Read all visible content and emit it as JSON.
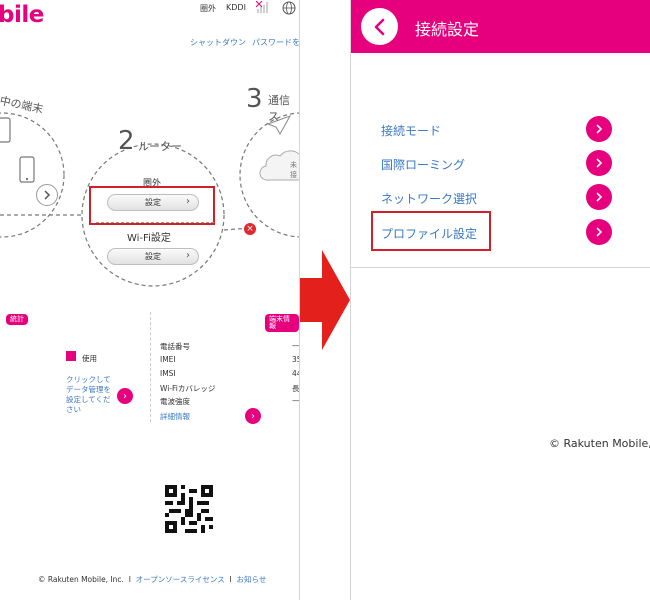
{
  "left": {
    "logo": "bile",
    "top": {
      "status": "圏外",
      "carrier": "KDDI"
    },
    "links": {
      "shutdown": "シャットダウン",
      "password": "パスワードを"
    },
    "devices_label": "中の端末",
    "router_num": "2",
    "router_label": "ルーター",
    "comm_num": "3",
    "comm_label": "通信ス",
    "cloud_text": "未接",
    "router_status": "圏外",
    "settings_btn": "設定",
    "wifi_label": "Wi-Fi設定",
    "wifi_btn": "設定",
    "stats_tag": "統計",
    "info_tag": "端末情報",
    "usage_label": "使用",
    "data_link": [
      "クリックして",
      "データ管理を",
      "設定してくだ",
      "さい"
    ],
    "info_rows": [
      {
        "label": "電話番号",
        "value": "—"
      },
      {
        "label": "IMEI",
        "value": "35"
      },
      {
        "label": "IMSI",
        "value": "44"
      },
      {
        "label": "Wi-Fiカバレッジ",
        "value": "長"
      },
      {
        "label": "電波強度",
        "value": "—"
      }
    ],
    "detail_link": "詳細情報",
    "footer": {
      "copyright": "© Rakuten Mobile, Inc.",
      "sep": "I",
      "oss": "オープンソースライセンス",
      "notice": "お知らせ"
    }
  },
  "right": {
    "title": "接続設定",
    "menu": [
      {
        "label": "接続モード"
      },
      {
        "label": "国際ローミング"
      },
      {
        "label": "ネットワーク選択"
      },
      {
        "label": "プロファイル設定"
      }
    ],
    "footer": "© Rakuten Mobile,"
  },
  "colors": {
    "brand": "#e6007e",
    "link": "#3a79c4",
    "highlight": "#d0202a",
    "arrow": "#e3201b"
  }
}
